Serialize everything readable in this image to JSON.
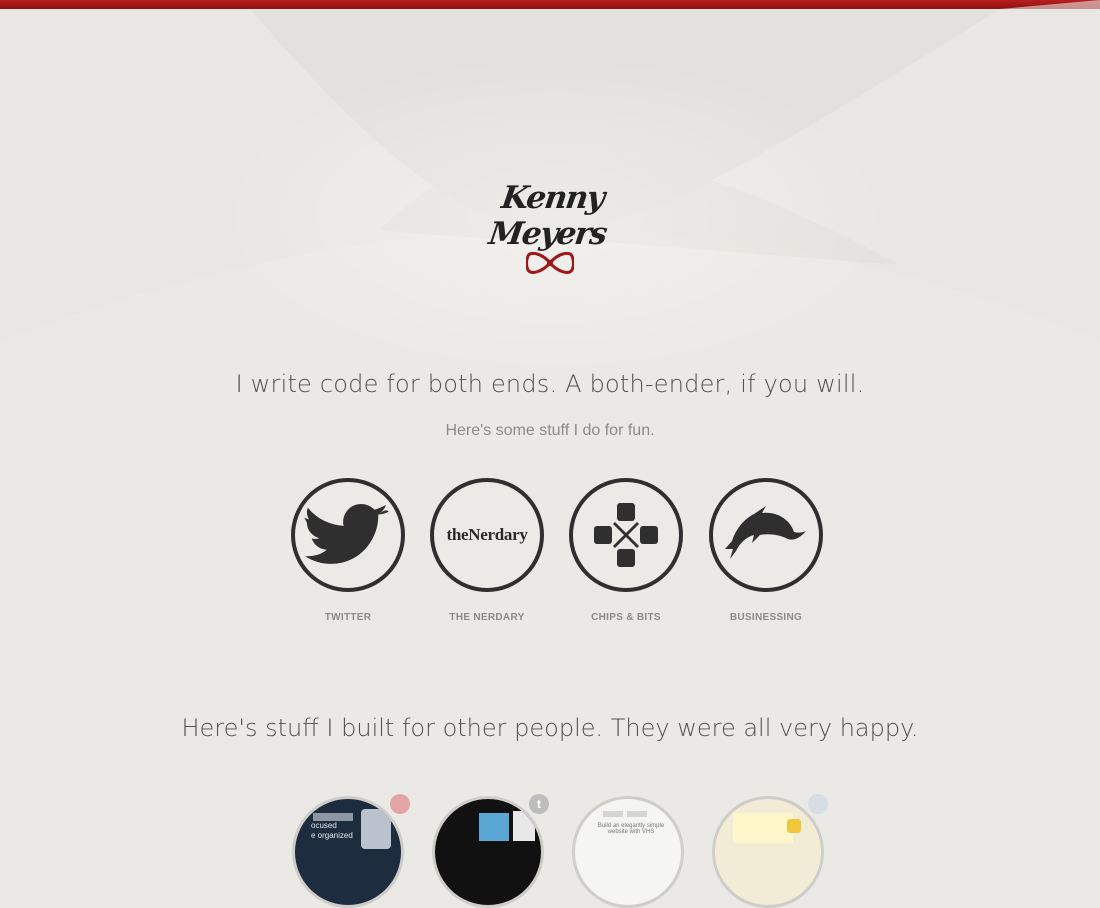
{
  "logo": {
    "text": "Kenny Meyers"
  },
  "intro": {
    "tagline": "I write code for both ends. A both-ender, if you will.",
    "subtagline": "Here's some stuff I do for fun."
  },
  "links": [
    {
      "label": "TWITTER",
      "icon": "twitter-bird-icon"
    },
    {
      "label": "THE NERDARY",
      "icon": "thenerdary-logo",
      "logo_text": "theNerdary"
    },
    {
      "label": "CHIPS & BITS",
      "icon": "gamepad-dpad-icon"
    },
    {
      "label": "BUSINESSING",
      "icon": "dolphin-icon"
    }
  ],
  "portfolio": {
    "heading": "Here's stuff I built for other people. They were all very happy.",
    "items": [
      {
        "preview_text_1": "ocused",
        "preview_text_2": "e organized",
        "badge_icon": "br-badge-icon"
      },
      {
        "badge_icon": "tumblr-badge-icon",
        "badge_text": "t"
      },
      {
        "preview_text": "Build an elegantly simple website with VHS",
        "badge_icon": "none"
      },
      {
        "badge_icon": "note-badge-icon"
      }
    ]
  },
  "colors": {
    "accent": "#a11616",
    "background": "#ebe9e5",
    "icon": "#2f2f2f",
    "label": "#8a8a8a"
  }
}
